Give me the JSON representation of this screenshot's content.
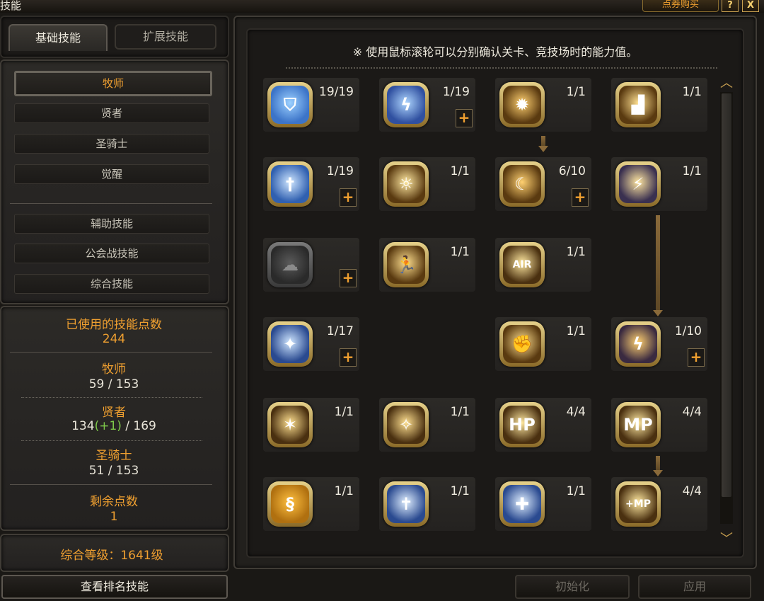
{
  "window": {
    "title": "技能",
    "buy_label": "点券购买",
    "help_label": "?",
    "close_label": "X"
  },
  "tabs": {
    "basic": "基础技能",
    "extended": "扩展技能"
  },
  "classes": [
    "牧师",
    "贤者",
    "圣骑士",
    "觉醒"
  ],
  "categories": [
    "辅助技能",
    "公会战技能",
    "综合技能"
  ],
  "stats": {
    "used_label": "已使用的技能点数",
    "used_value": "244",
    "priest_label": "牧师",
    "priest_value": "59 / 153",
    "sage_label": "贤者",
    "sage_value_a": "134",
    "sage_value_bonus": "(+1)",
    "sage_value_b": " / 169",
    "paladin_label": "圣骑士",
    "paladin_value": "51 / 153",
    "remaining_label": "剩余点数",
    "remaining_value": "1",
    "overall_level": "综合等级：1641级"
  },
  "buttons": {
    "ranking": "查看排名技能",
    "reset": "初始化",
    "apply": "应用"
  },
  "hint": "※ 使用鼠标滚轮可以分别确认关卡、竞技场时的能力值。",
  "skills": [
    {
      "id": "shield",
      "level": "19/19",
      "plus": false,
      "icon": "shield-icon"
    },
    {
      "id": "lightning",
      "level": "1/19",
      "plus": true,
      "icon": "lightning-icon"
    },
    {
      "id": "strike",
      "level": "1/1",
      "plus": false,
      "icon": "strike-icon"
    },
    {
      "id": "boot",
      "level": "1/1",
      "plus": false,
      "icon": "boot-icon"
    },
    {
      "id": "cross-orb",
      "level": "1/19",
      "plus": true,
      "icon": "cross-orb-icon"
    },
    {
      "id": "sun-figure",
      "level": "1/1",
      "plus": false,
      "icon": "sun-figure-icon"
    },
    {
      "id": "swirl",
      "level": "6/10",
      "plus": true,
      "icon": "swirl-icon"
    },
    {
      "id": "slash",
      "level": "1/1",
      "plus": false,
      "icon": "slash-icon"
    },
    {
      "id": "locked-smoke",
      "level": "",
      "plus": true,
      "icon": "locked-smoke-icon"
    },
    {
      "id": "runner",
      "level": "1/1",
      "plus": false,
      "icon": "runner-icon"
    },
    {
      "id": "air",
      "level": "1/1",
      "plus": false,
      "icon": "air-icon"
    },
    {
      "id": "star-orb",
      "level": "1/17",
      "plus": true,
      "icon": "star-orb-icon"
    },
    {
      "id": "uppercut",
      "level": "1/1",
      "plus": false,
      "icon": "uppercut-icon"
    },
    {
      "id": "lightning-kick",
      "level": "1/10",
      "plus": true,
      "icon": "lightning-kick-icon"
    },
    {
      "id": "burst",
      "level": "1/1",
      "plus": false,
      "icon": "burst-icon"
    },
    {
      "id": "rise",
      "level": "1/1",
      "plus": false,
      "icon": "rise-icon"
    },
    {
      "id": "hp",
      "level": "4/4",
      "plus": false,
      "icon": "hp-icon"
    },
    {
      "id": "mp",
      "level": "4/4",
      "plus": false,
      "icon": "mp-icon"
    },
    {
      "id": "dragon",
      "level": "1/1",
      "plus": false,
      "icon": "dragon-icon"
    },
    {
      "id": "cross-shield",
      "level": "1/1",
      "plus": false,
      "icon": "cross-shield-icon"
    },
    {
      "id": "heal-cross",
      "level": "1/1",
      "plus": false,
      "icon": "heal-cross-icon"
    },
    {
      "id": "mp-plus",
      "level": "4/4",
      "plus": false,
      "icon": "mp-plus-icon"
    }
  ]
}
